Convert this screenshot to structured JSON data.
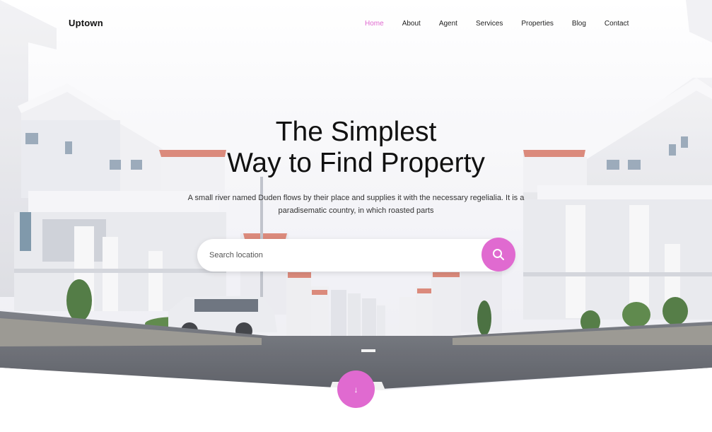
{
  "brand": {
    "name": "Uptown"
  },
  "nav": {
    "items": [
      {
        "label": "Home",
        "active": true
      },
      {
        "label": "About",
        "active": false
      },
      {
        "label": "Agent",
        "active": false
      },
      {
        "label": "Services",
        "active": false
      },
      {
        "label": "Properties",
        "active": false
      },
      {
        "label": "Blog",
        "active": false
      },
      {
        "label": "Contact",
        "active": false
      }
    ]
  },
  "hero": {
    "title_line1": "The Simplest",
    "title_line2": "Way to Find Property",
    "subtitle": "A small river named Duden flows by their place and supplies it with the necessary regelialia. It is a paradisematic country, in which roasted parts"
  },
  "search": {
    "value": "",
    "placeholder": "Search location",
    "button_icon": "search-icon"
  },
  "scroll": {
    "arrow": "↓",
    "icon": "arrow-down-icon"
  },
  "colors": {
    "accent": "#e06ad0",
    "text": "#111111",
    "background": "#ffffff"
  }
}
